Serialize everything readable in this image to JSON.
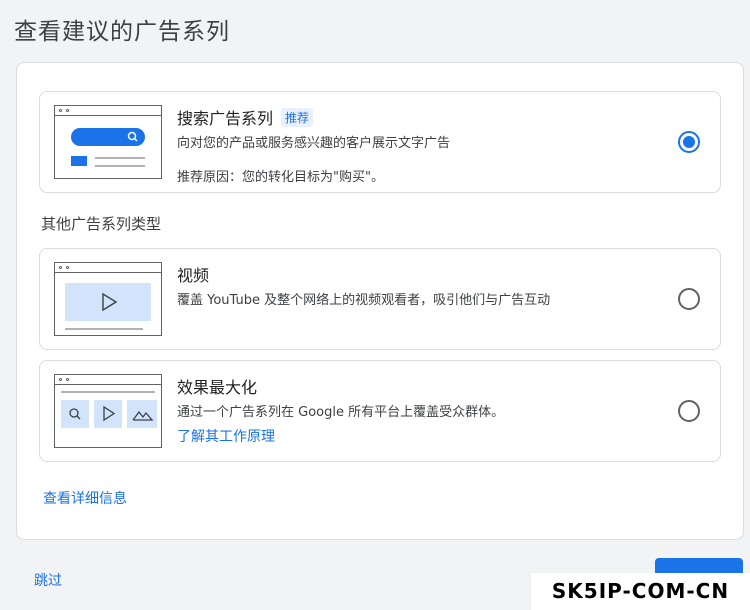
{
  "page": {
    "title": "查看建议的广告系列"
  },
  "recommended": {
    "title": "搜索广告系列",
    "badge": "推荐",
    "description": "向对您的产品或服务感兴趣的客户展示文字广告",
    "reason": "推荐原因：您的转化目标为\"购买\"。",
    "selected": true
  },
  "other_section": {
    "label": "其他广告系列类型"
  },
  "video": {
    "title": "视频",
    "description": "覆盖 YouTube 及整个网络上的视频观看者，吸引他们与广告互动",
    "selected": false
  },
  "pmax": {
    "title": "效果最大化",
    "description": "通过一个广告系列在 Google 所有平台上覆盖受众群体。",
    "link": "了解其工作原理",
    "selected": false
  },
  "footer": {
    "details_link": "查看详细信息",
    "skip_link": "跳过"
  },
  "watermark": {
    "text": "SK5IP-COM-CN"
  },
  "colors": {
    "accent": "#1a73e8",
    "illustration_fill": "#d2e3fc"
  }
}
